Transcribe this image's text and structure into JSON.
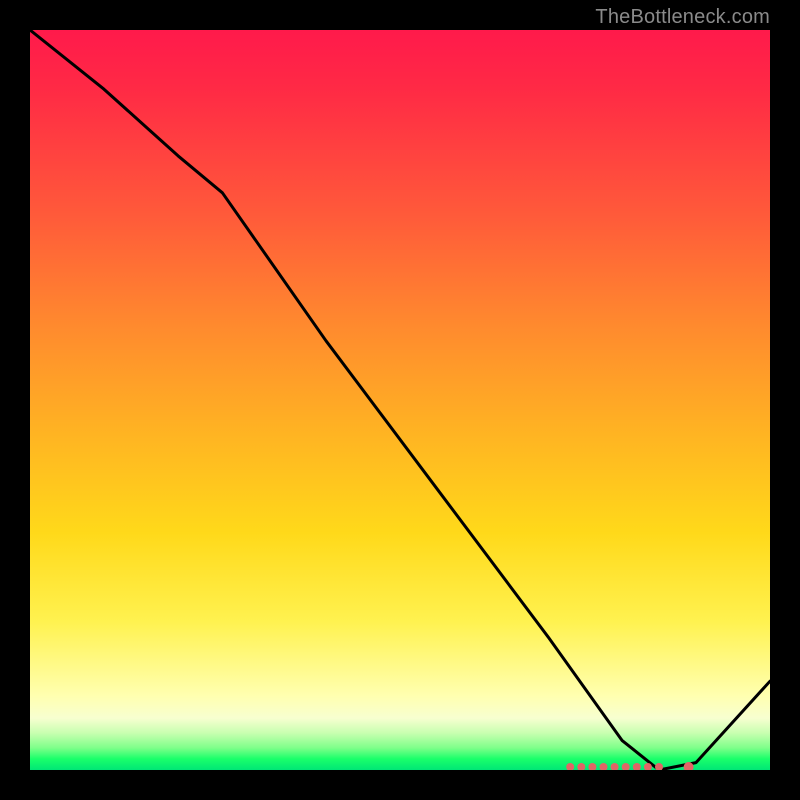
{
  "watermark": "TheBottleneck.com",
  "chart_data": {
    "type": "line",
    "title": "",
    "xlabel": "",
    "ylabel": "",
    "xlim": [
      0,
      100
    ],
    "ylim": [
      0,
      100
    ],
    "series": [
      {
        "name": "curve",
        "x": [
          0,
          10,
          20,
          26,
          40,
          55,
          70,
          80,
          85,
          90,
          100
        ],
        "y": [
          100,
          92,
          83,
          78,
          58,
          38,
          18,
          4,
          0,
          1,
          12
        ]
      }
    ],
    "markers": {
      "name": "baseline-dots",
      "color": "#e06666",
      "x": [
        73,
        74.5,
        76,
        77.5,
        79,
        80.5,
        82,
        83.5,
        85,
        89
      ],
      "y": [
        0,
        0,
        0,
        0,
        0,
        0,
        0,
        0,
        0,
        0
      ]
    },
    "gradient_stops": [
      {
        "pos": 0.0,
        "color": "#ff1a4b"
      },
      {
        "pos": 0.4,
        "color": "#ff8a2e"
      },
      {
        "pos": 0.7,
        "color": "#ffe01a"
      },
      {
        "pos": 0.9,
        "color": "#ffffb0"
      },
      {
        "pos": 1.0,
        "color": "#00e676"
      }
    ]
  }
}
